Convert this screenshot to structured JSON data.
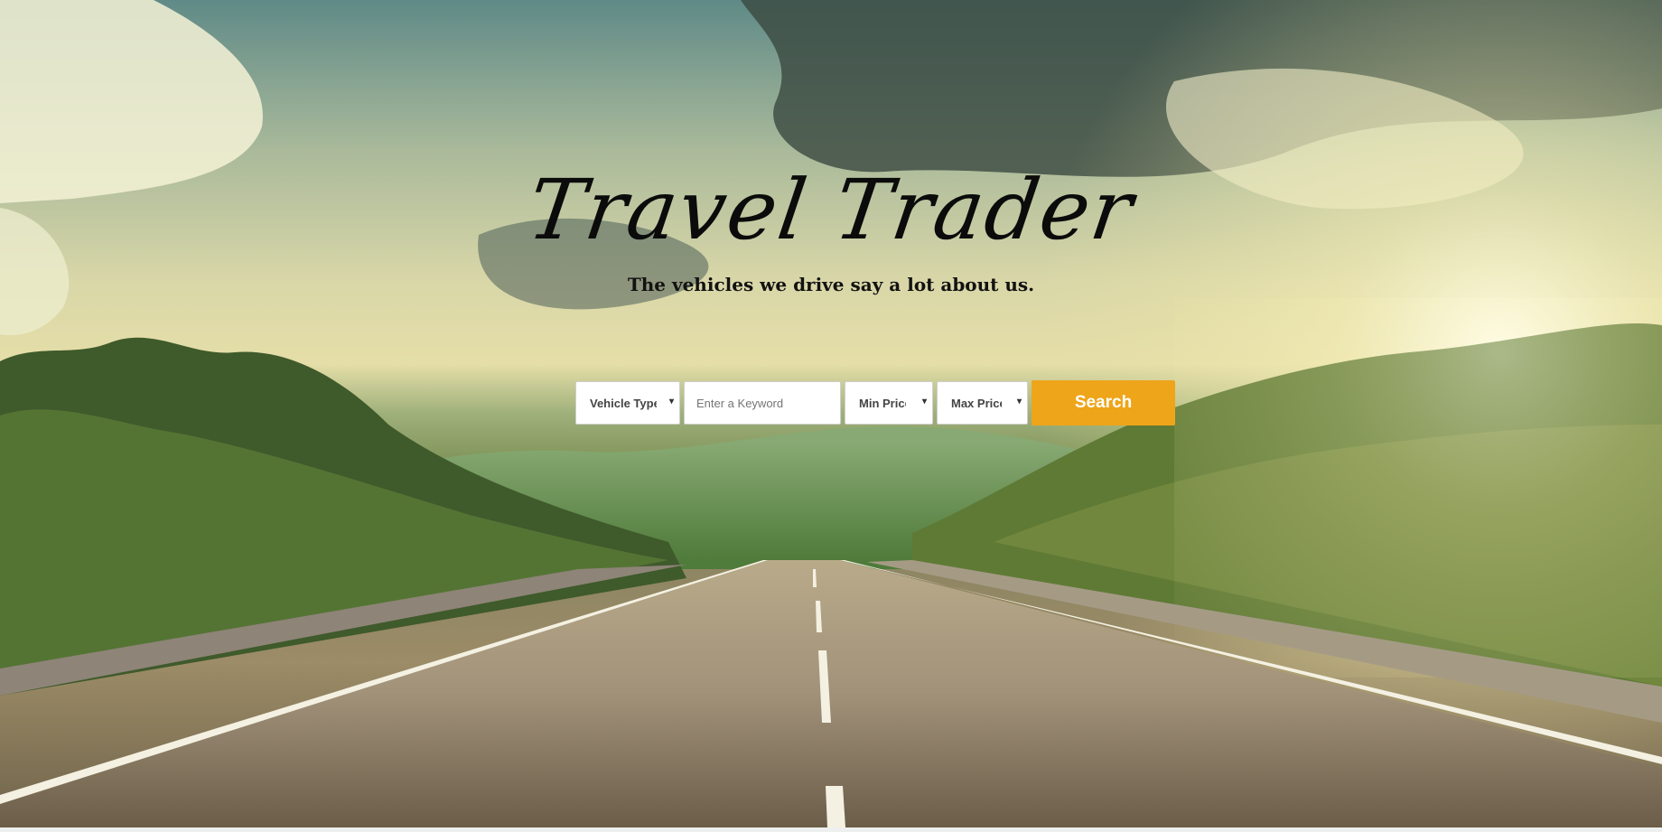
{
  "hero": {
    "title": "Travel Trader",
    "subtitle": "The vehicles we drive say a lot about us."
  },
  "search": {
    "vehicle_type": "Vehicle Type",
    "keyword_placeholder": "Enter a Keyword",
    "min_price": "Min Price",
    "max_price": "Max Price",
    "button_label": "Search",
    "caret": "▾"
  },
  "colors": {
    "search_button": "#eea519",
    "title_text": "#0b0b0b"
  }
}
